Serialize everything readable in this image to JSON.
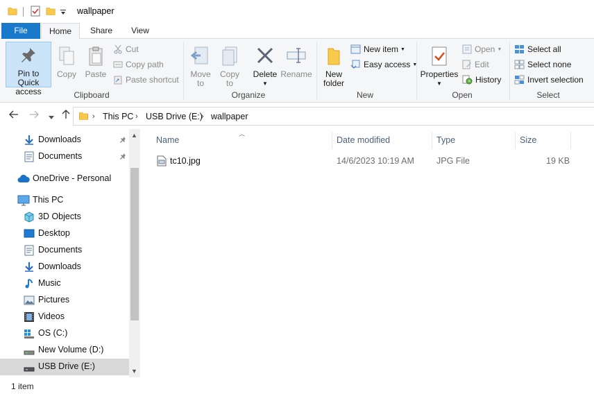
{
  "window": {
    "title": "wallpaper"
  },
  "tabs": {
    "file": "File",
    "home": "Home",
    "share": "Share",
    "view": "View"
  },
  "ribbon": {
    "clipboard": {
      "label": "Clipboard",
      "pin_line1": "Pin to Quick",
      "pin_line2": "access",
      "copy": "Copy",
      "paste": "Paste",
      "cut": "Cut",
      "copy_path": "Copy path",
      "paste_shortcut": "Paste shortcut"
    },
    "organize": {
      "label": "Organize",
      "move_to_1": "Move",
      "move_to_2": "to",
      "copy_to_1": "Copy",
      "copy_to_2": "to",
      "delete": "Delete",
      "rename": "Rename"
    },
    "new": {
      "label": "New",
      "new_folder_1": "New",
      "new_folder_2": "folder",
      "new_item": "New item",
      "easy_access": "Easy access"
    },
    "open": {
      "label": "Open",
      "properties": "Properties",
      "open": "Open",
      "edit": "Edit",
      "history": "History"
    },
    "select": {
      "label": "Select",
      "select_all": "Select all",
      "select_none": "Select none",
      "invert_selection": "Invert selection"
    }
  },
  "address": {
    "crumbs": [
      "This PC",
      "USB Drive (E:)",
      "wallpaper"
    ]
  },
  "nav": {
    "items": [
      {
        "label": "Downloads"
      },
      {
        "label": "Documents"
      },
      {
        "label": "OneDrive - Personal"
      },
      {
        "label": "This PC"
      },
      {
        "label": "3D Objects"
      },
      {
        "label": "Desktop"
      },
      {
        "label": "Documents"
      },
      {
        "label": "Downloads"
      },
      {
        "label": "Music"
      },
      {
        "label": "Pictures"
      },
      {
        "label": "Videos"
      },
      {
        "label": "OS (C:)"
      },
      {
        "label": "New Volume (D:)"
      },
      {
        "label": "USB Drive (E:)"
      }
    ]
  },
  "columns": {
    "name": "Name",
    "date": "Date modified",
    "type": "Type",
    "size": "Size"
  },
  "files": [
    {
      "name": "tc10.jpg",
      "date": "14/6/2023 10:19 AM",
      "type": "JPG File",
      "size": "19 KB"
    }
  ],
  "status": {
    "count": "1 item"
  },
  "colors": {
    "accent": "#1979ca",
    "folder": "#f8c94a",
    "selected": "#d9d9d9"
  }
}
